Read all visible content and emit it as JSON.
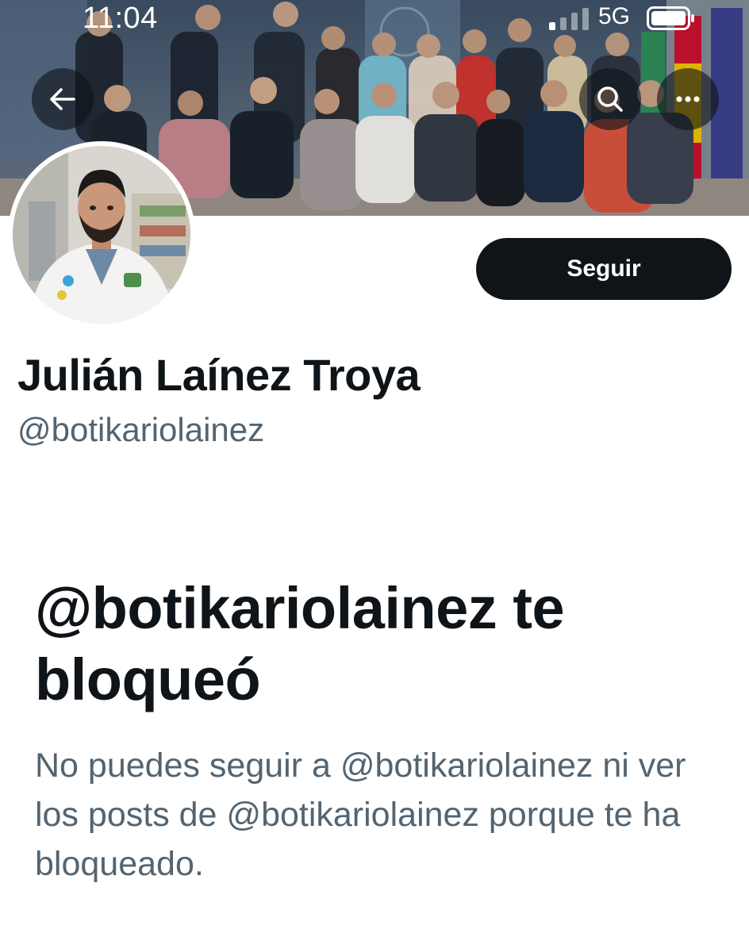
{
  "status_bar": {
    "time": "11:04",
    "network": "5G",
    "signal_icon": "cellular-signal-icon",
    "battery_icon": "battery-icon"
  },
  "header": {
    "back_icon": "arrow-left-icon",
    "search_icon": "search-icon",
    "more_icon": "more-options-icon"
  },
  "profile": {
    "display_name": "Julián Laínez Troya",
    "handle": "@botikariolainez",
    "follow_label": "Seguir"
  },
  "blocked": {
    "title": "@botikariolainez te bloqueó",
    "description": "No puedes seguir a @botikariolainez ni ver los posts de @botikariolainez porque te ha bloqueado."
  },
  "colors": {
    "text_primary": "#0f1419",
    "text_secondary": "#536471",
    "button_bg": "#0f1419",
    "background": "#ffffff"
  }
}
